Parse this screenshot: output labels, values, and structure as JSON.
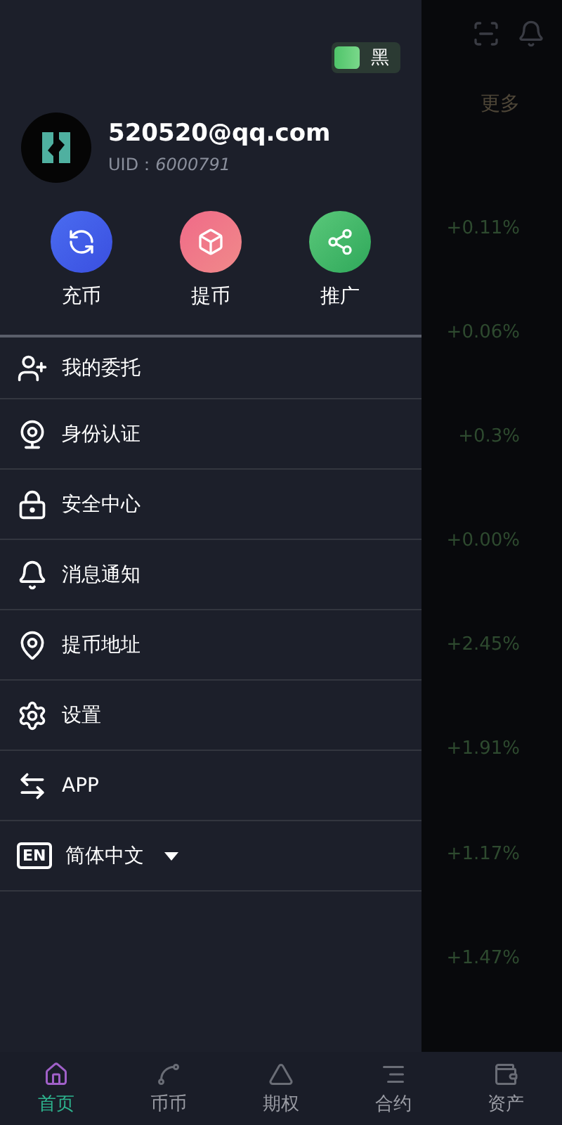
{
  "theme_toggle": {
    "label": "黑",
    "on": true
  },
  "user": {
    "email": "520520@qq.com",
    "uid_label": "UID：",
    "uid": "6000791"
  },
  "actions": [
    {
      "label": "充币",
      "kind": "deposit"
    },
    {
      "label": "提币",
      "kind": "withdraw"
    },
    {
      "label": "推广",
      "kind": "share"
    }
  ],
  "menu": [
    {
      "label": "我的委托",
      "kind": "orders"
    },
    {
      "label": "身份认证",
      "kind": "identity"
    },
    {
      "label": "安全中心",
      "kind": "security"
    },
    {
      "label": "消息通知",
      "kind": "notice"
    },
    {
      "label": "提币地址",
      "kind": "address"
    },
    {
      "label": "设置",
      "kind": "settings"
    },
    {
      "label": "APP",
      "kind": "app"
    },
    {
      "label": "简体中文",
      "kind": "language",
      "badge": "EN",
      "dropdown": true
    }
  ],
  "backdrop": {
    "more": "更多",
    "changes": [
      "+0.11%",
      "+0.06%",
      "+0.3%",
      "+0.00%",
      "+2.45%",
      "+1.91%",
      "+1.17%",
      "+1.47%"
    ]
  },
  "nav": [
    {
      "label": "首页",
      "kind": "home",
      "selected": true
    },
    {
      "label": "币币",
      "kind": "spot",
      "selected": false
    },
    {
      "label": "期权",
      "kind": "options",
      "selected": false
    },
    {
      "label": "合约",
      "kind": "contract",
      "selected": false
    },
    {
      "label": "资产",
      "kind": "assets",
      "selected": false
    }
  ]
}
